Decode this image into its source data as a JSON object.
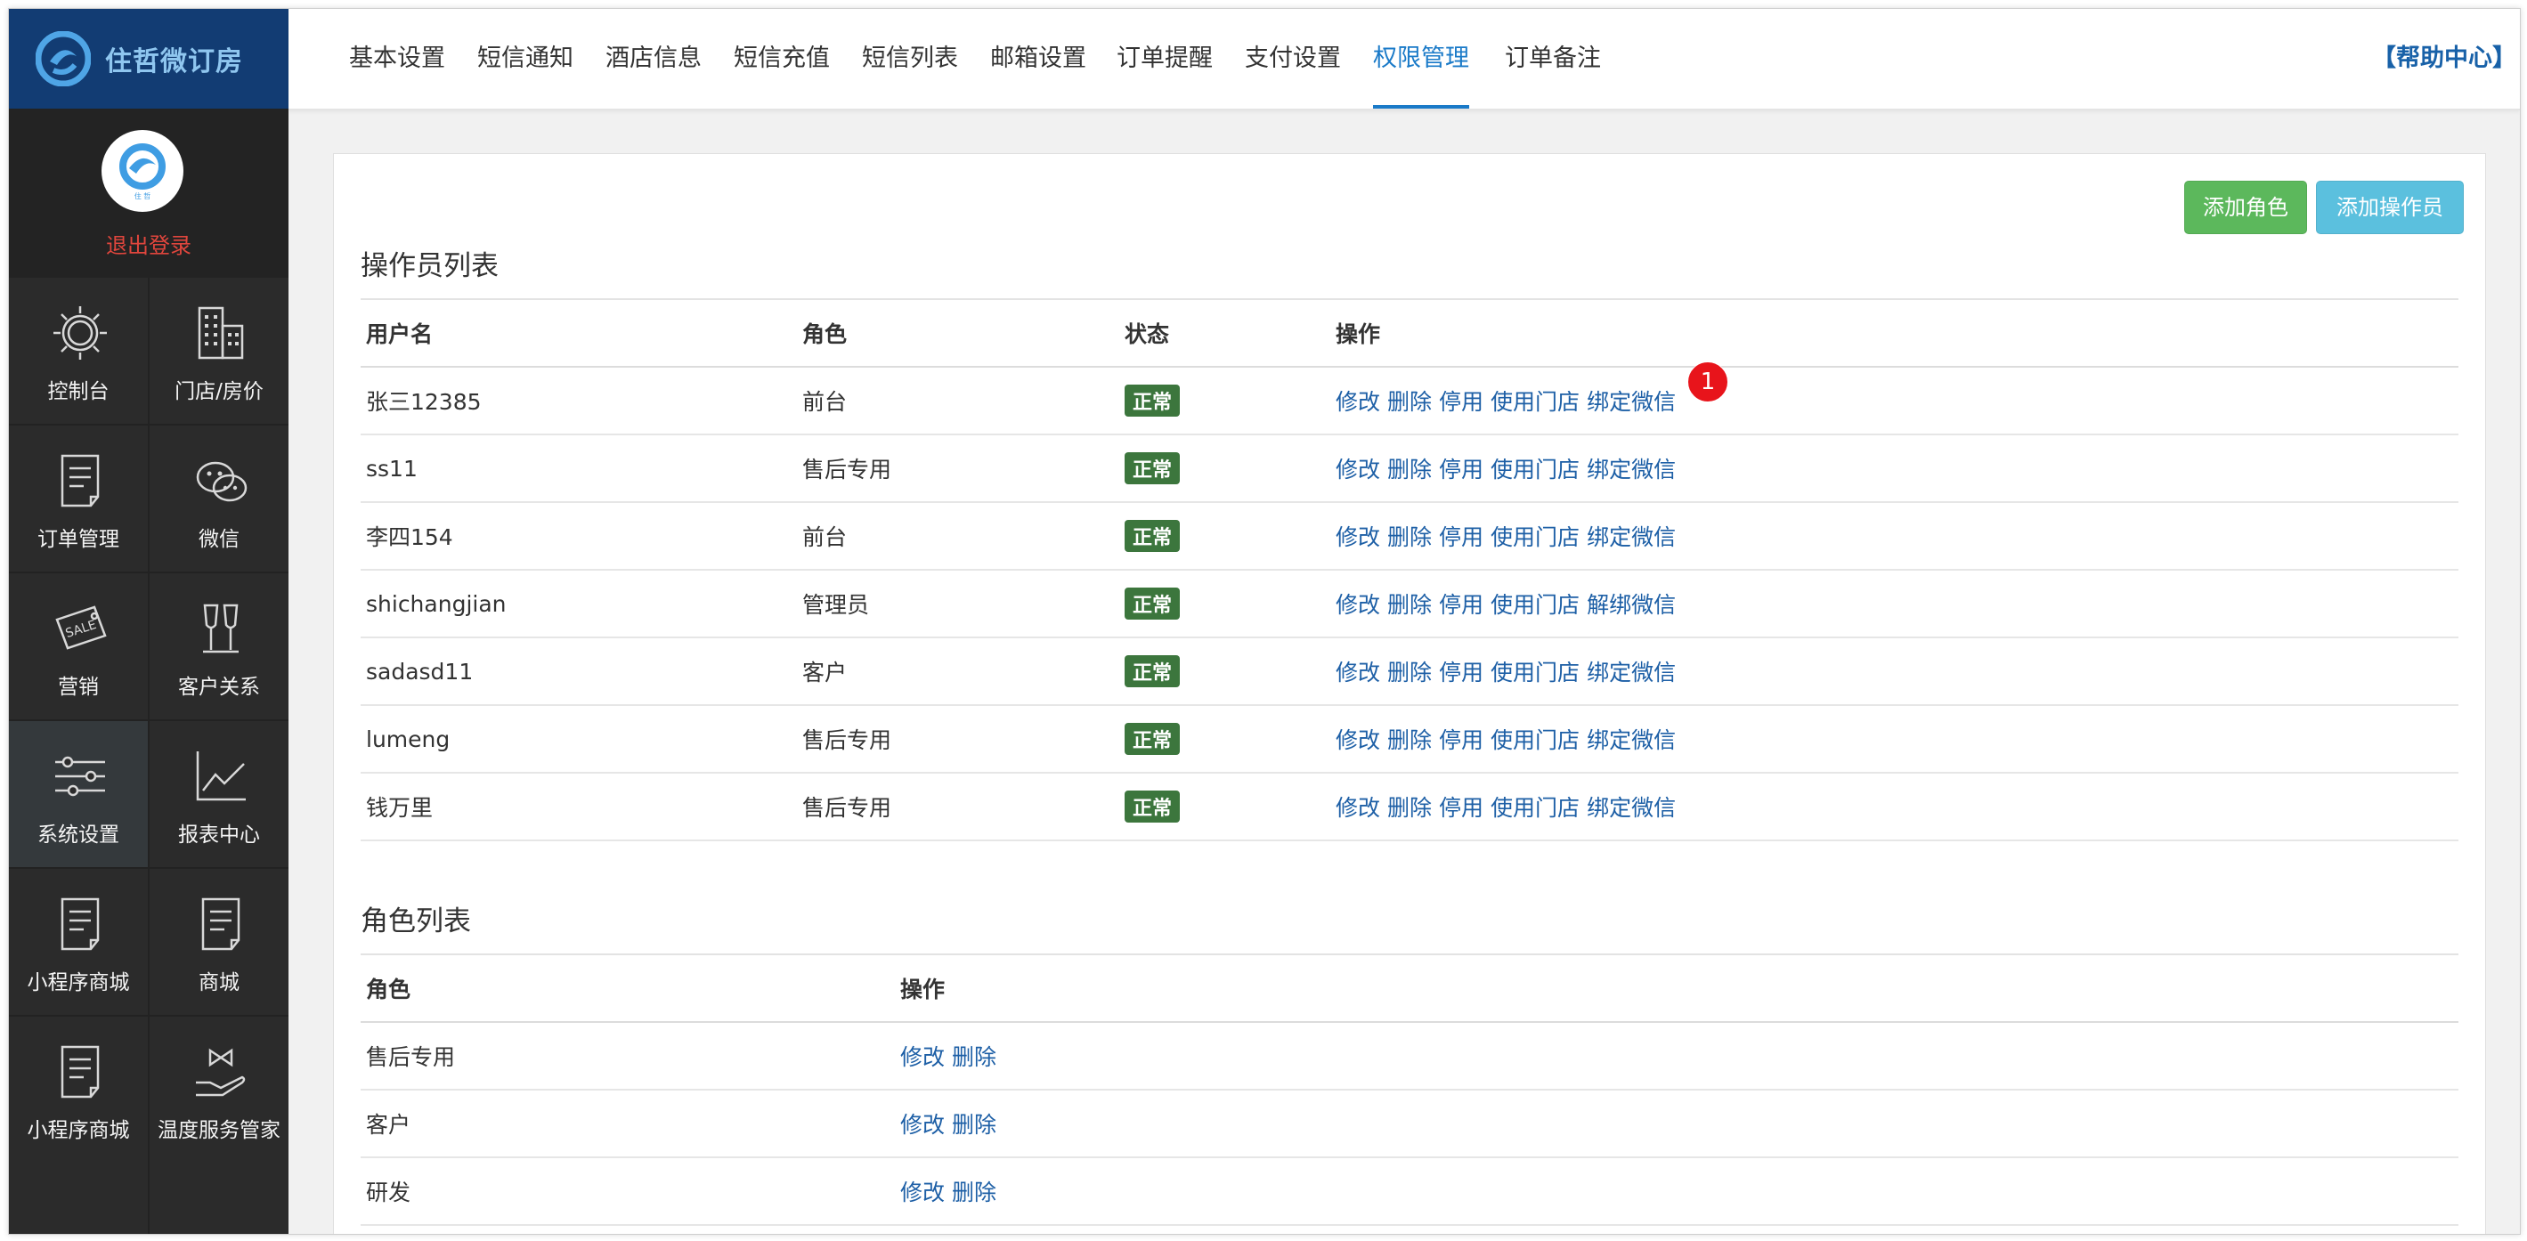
{
  "brand": {
    "name": "住哲微订房",
    "avatar_text": "住 哲"
  },
  "sidebar": {
    "logout": "退出登录",
    "items": [
      {
        "label": "控制台",
        "icon": "sun-icon"
      },
      {
        "label": "门店/房价",
        "icon": "building-icon"
      },
      {
        "label": "订单管理",
        "icon": "document-icon"
      },
      {
        "label": "微信",
        "icon": "wechat-icon"
      },
      {
        "label": "营销",
        "icon": "sale-tag-icon"
      },
      {
        "label": "客户关系",
        "icon": "wine-glasses-icon"
      },
      {
        "label": "系统设置",
        "icon": "sliders-icon"
      },
      {
        "label": "报表中心",
        "icon": "line-chart-icon"
      },
      {
        "label": "小程序商城",
        "icon": "document-icon"
      },
      {
        "label": "商城",
        "icon": "document-icon"
      },
      {
        "label": "小程序商城",
        "icon": "document-icon"
      },
      {
        "label": "温度服务管家",
        "icon": "service-hand-icon"
      }
    ],
    "active_index": 6
  },
  "topnav": {
    "tabs": [
      "基本设置",
      "短信通知",
      "酒店信息",
      "短信充值",
      "短信列表",
      "邮箱设置",
      "订单提醒",
      "支付设置",
      "权限管理",
      "订单备注"
    ],
    "active_index": 8,
    "help": "【帮助中心】"
  },
  "actions": {
    "add_role": "添加角色",
    "add_operator": "添加操作员"
  },
  "operators": {
    "title": "操作员列表",
    "columns": [
      "用户名",
      "角色",
      "状态",
      "操作"
    ],
    "rows": [
      {
        "username": "张三12385",
        "role": "前台",
        "status": "正常",
        "ops": [
          "修改",
          "删除",
          "停用",
          "使用门店",
          "绑定微信"
        ]
      },
      {
        "username": "ss11",
        "role": "售后专用",
        "status": "正常",
        "ops": [
          "修改",
          "删除",
          "停用",
          "使用门店",
          "绑定微信"
        ]
      },
      {
        "username": "李四154",
        "role": "前台",
        "status": "正常",
        "ops": [
          "修改",
          "删除",
          "停用",
          "使用门店",
          "绑定微信"
        ]
      },
      {
        "username": "shichangjian",
        "role": "管理员",
        "status": "正常",
        "ops": [
          "修改",
          "删除",
          "停用",
          "使用门店",
          "解绑微信"
        ]
      },
      {
        "username": "sadasd11",
        "role": "客户",
        "status": "正常",
        "ops": [
          "修改",
          "删除",
          "停用",
          "使用门店",
          "绑定微信"
        ]
      },
      {
        "username": "lumeng",
        "role": "售后专用",
        "status": "正常",
        "ops": [
          "修改",
          "删除",
          "停用",
          "使用门店",
          "绑定微信"
        ]
      },
      {
        "username": "钱万里",
        "role": "售后专用",
        "status": "正常",
        "ops": [
          "修改",
          "删除",
          "停用",
          "使用门店",
          "绑定微信"
        ]
      }
    ]
  },
  "roles": {
    "title": "角色列表",
    "columns": [
      "角色",
      "操作"
    ],
    "rows": [
      {
        "role": "售后专用",
        "ops": [
          "修改",
          "删除"
        ]
      },
      {
        "role": "客户",
        "ops": [
          "修改",
          "删除"
        ]
      },
      {
        "role": "研发",
        "ops": [
          "修改",
          "删除"
        ]
      }
    ]
  },
  "notification_badge": "1",
  "colors": {
    "accent": "#1a7ac8",
    "status_ok": "#3c763d",
    "link": "#1d5fa6",
    "brand_bg": "#123c73",
    "logout": "#e0463d"
  }
}
